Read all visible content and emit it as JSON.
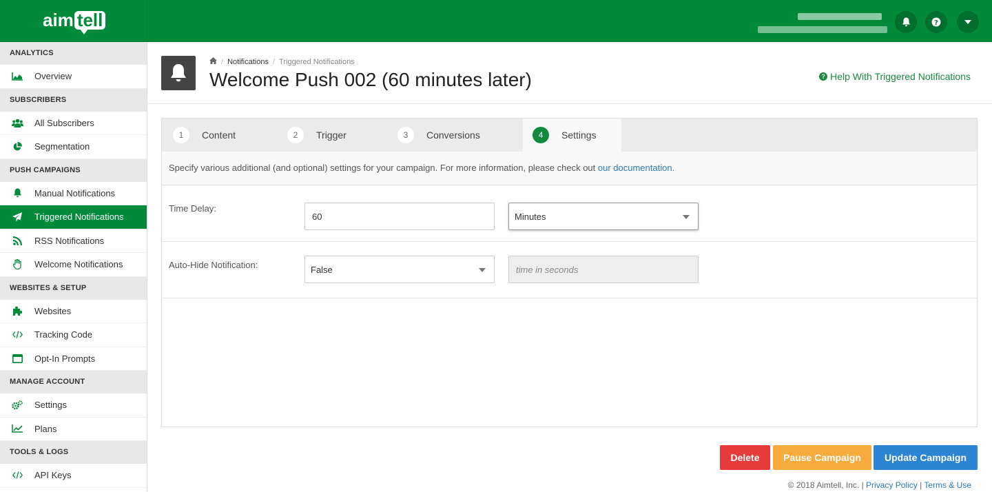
{
  "brand": {
    "logo_left": "aim",
    "logo_right": "tell"
  },
  "topbar": {
    "bell_icon": "bell-icon",
    "help_icon": "question-icon",
    "menu_icon": "caret-down-icon"
  },
  "sidebar": {
    "sections": [
      {
        "title": "ANALYTICS",
        "items": [
          {
            "label": "Overview",
            "icon": "area-chart-icon"
          }
        ]
      },
      {
        "title": "SUBSCRIBERS",
        "items": [
          {
            "label": "All Subscribers",
            "icon": "users-icon"
          },
          {
            "label": "Segmentation",
            "icon": "pie-chart-icon"
          }
        ]
      },
      {
        "title": "PUSH CAMPAIGNS",
        "items": [
          {
            "label": "Manual Notifications",
            "icon": "bell-icon"
          },
          {
            "label": "Triggered Notifications",
            "icon": "paper-plane-icon",
            "active": true
          },
          {
            "label": "RSS Notifications",
            "icon": "rss-icon"
          },
          {
            "label": "Welcome Notifications",
            "icon": "hand-wave-icon"
          }
        ]
      },
      {
        "title": "WEBSITES & SETUP",
        "items": [
          {
            "label": "Websites",
            "icon": "puzzle-icon"
          },
          {
            "label": "Tracking Code",
            "icon": "code-icon"
          },
          {
            "label": "Opt-In Prompts",
            "icon": "window-icon"
          }
        ]
      },
      {
        "title": "MANAGE ACCOUNT",
        "items": [
          {
            "label": "Settings",
            "icon": "cogs-icon"
          },
          {
            "label": "Plans",
            "icon": "line-chart-icon"
          }
        ]
      },
      {
        "title": "TOOLS & LOGS",
        "items": [
          {
            "label": "API Keys",
            "icon": "code-icon"
          }
        ]
      }
    ]
  },
  "breadcrumb": {
    "home_icon": "home-icon",
    "items": [
      "Notifications",
      "Triggered Notifications"
    ]
  },
  "page": {
    "title": "Welcome Push 002 (60 minutes later)",
    "help_link": "Help With Triggered Notifications"
  },
  "tabs": [
    {
      "num": "1",
      "label": "Content"
    },
    {
      "num": "2",
      "label": "Trigger"
    },
    {
      "num": "3",
      "label": "Conversions"
    },
    {
      "num": "4",
      "label": "Settings",
      "active": true
    }
  ],
  "settings": {
    "description": "Specify various additional (and optional) settings for your campaign. For more information, please check out ",
    "doc_link": "our documentation",
    "doc_suffix": ".",
    "time_delay": {
      "label": "Time Delay:",
      "value": "60",
      "unit": "Minutes"
    },
    "auto_hide": {
      "label": "Auto-Hide Notification:",
      "value": "False",
      "seconds_placeholder": "time in seconds"
    }
  },
  "actions": {
    "delete": {
      "label": "Delete",
      "color": "#e63b3b"
    },
    "pause": {
      "label": "Pause Campaign",
      "color": "#f7ab3c"
    },
    "update": {
      "label": "Update Campaign",
      "color": "#2d84d2"
    }
  },
  "footer": {
    "copyright": "© 2018 Aimtell, Inc. |",
    "privacy": "Privacy Policy",
    "sep": "|",
    "terms": "Terms & Use"
  }
}
